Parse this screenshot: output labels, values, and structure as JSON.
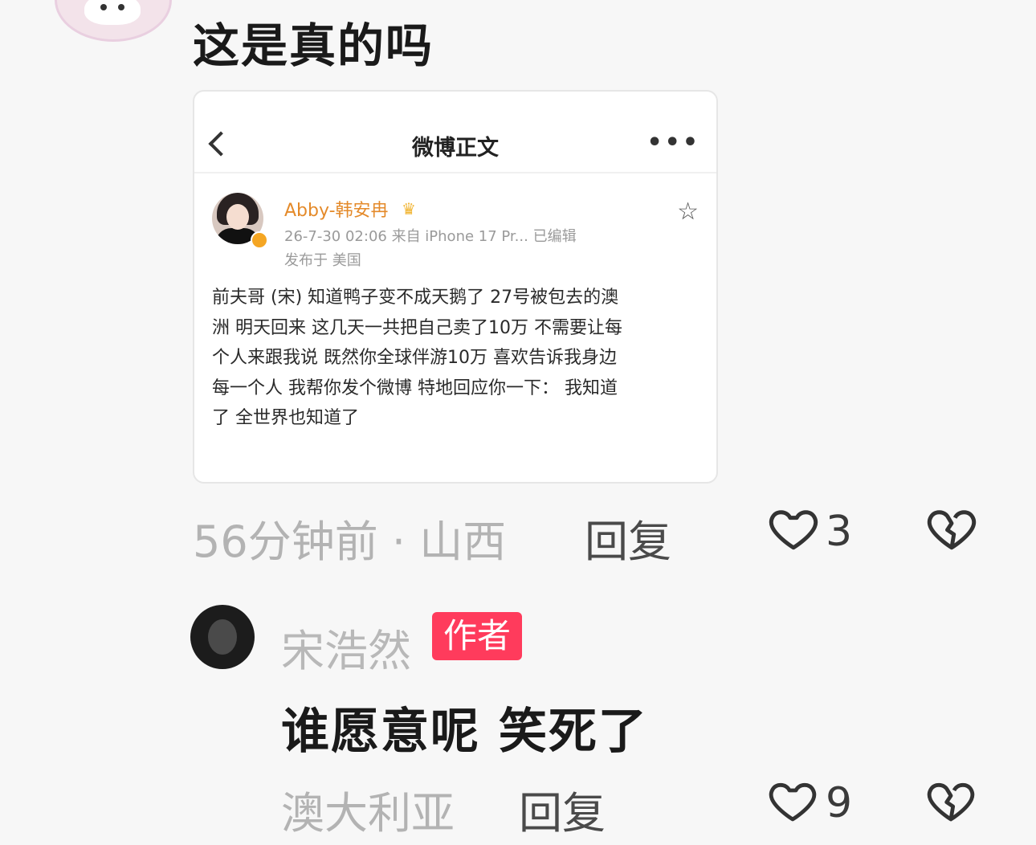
{
  "comment1": {
    "text": "这是真的吗",
    "time_location": "56分钟前 · 山西",
    "reply_label": "回复",
    "like_count": "3",
    "screenshot": {
      "header_title": "微博正文",
      "more_label": "•••",
      "username": "Abby-韩安冉",
      "meta": "26-7-30 02:06  来自 iPhone 17 Pr...  已编辑",
      "location": "发布于 美国",
      "body_lines": [
        "前夫哥 (宋) 知道鸭子变不成天鹅了 27号被包去的澳",
        "洲 明天回来 这几天一共把自己卖了10万 不需要让每",
        "个人来跟我说 既然你全球伴游10万 喜欢告诉我身边",
        "每一个人 我帮你发个微博 特地回应你一下：  我知道",
        "了 全世界也知道了"
      ]
    }
  },
  "reply1": {
    "author": "宋浩然",
    "badge": "作者",
    "text": "谁愿意呢 笑死了",
    "location": "澳大利亚",
    "reply_label": "回复",
    "like_count": "9"
  },
  "colors": {
    "badge": "#ff3b5c",
    "username_orange": "#e48a2a",
    "background": "#f7f7f7"
  },
  "icons": [
    "back-icon",
    "more-icon",
    "star-icon",
    "crown-icon",
    "verified-icon",
    "heart-icon",
    "broken-heart-icon"
  ]
}
